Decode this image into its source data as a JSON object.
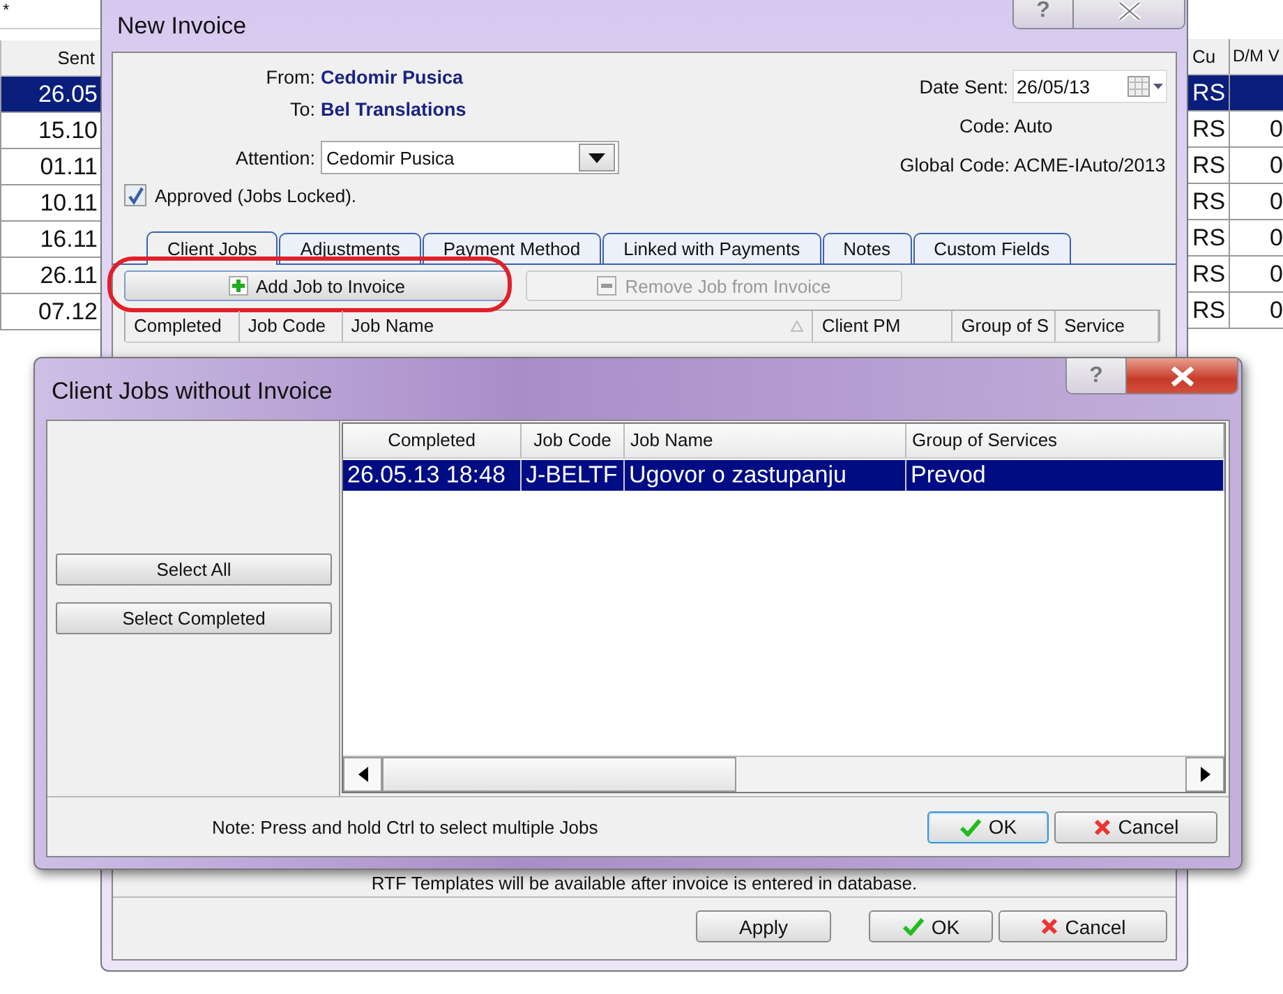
{
  "background": {
    "filter_text": "*",
    "columns": {
      "sent": "Sent",
      "cu": "Cu",
      "dm_v": "D/M V"
    },
    "rows": [
      {
        "sent": "26.05",
        "cu": "RS",
        "selected": true
      },
      {
        "sent": "15.10",
        "cu": "RS",
        "dm_v": "0",
        "selected": false
      },
      {
        "sent": "01.11",
        "cu": "RS",
        "dm_v": "0",
        "selected": false
      },
      {
        "sent": "10.11",
        "cu": "RS",
        "dm_v": "0",
        "selected": false
      },
      {
        "sent": "16.11",
        "cu": "RS",
        "dm_v": "0",
        "selected": false
      },
      {
        "sent": "26.11",
        "cu": "RS",
        "dm_v": "0",
        "selected": false
      },
      {
        "sent": "07.12",
        "cu": "RS",
        "dm_v": "0",
        "selected": false
      }
    ]
  },
  "invoice_window": {
    "title": "New Invoice",
    "help": "?",
    "from_label": "From:",
    "from": "Cedomir Pusica",
    "to_label": "To:",
    "to": "Bel Translations",
    "attention_label": "Attention:",
    "attention": "Cedomir Pusica",
    "approved": {
      "label": "Approved (Jobs Locked).",
      "checked": true
    },
    "date_sent_label": "Date Sent:",
    "date_sent": "26/05/13",
    "code_label": "Code:",
    "code": "Auto",
    "global_code_label": "Global Code:",
    "global_code": "ACME-IAuto/2013",
    "tabs": [
      {
        "label": "Client Jobs",
        "selected": true
      },
      {
        "label": "Adjustments",
        "selected": false
      },
      {
        "label": "Payment Method",
        "selected": false
      },
      {
        "label": "Linked with Payments",
        "selected": false
      },
      {
        "label": "Notes",
        "selected": false
      },
      {
        "label": "Custom Fields",
        "selected": false
      }
    ],
    "add_button": {
      "label": "Add Job to Invoice",
      "disabled": false,
      "circled": true
    },
    "remove_button": {
      "label": "Remove Job from Invoice",
      "disabled": true
    },
    "columns": [
      "Completed",
      "Job Code",
      "Job Name",
      "Client PM",
      "Group of S",
      "Service"
    ],
    "note": "RTF Templates will be available after invoice is entered in database.",
    "buttons": [
      {
        "kind": "plain",
        "label": "Apply"
      },
      {
        "kind": "ok",
        "label": "OK"
      },
      {
        "kind": "cancel",
        "label": "Cancel"
      }
    ]
  },
  "jobs_dialog": {
    "title": "Client Jobs without Invoice",
    "help": "?",
    "side_buttons": [
      "Select All",
      "Select Completed"
    ],
    "columns": [
      "Completed",
      "Job Code",
      "Job Name",
      "Group of Services"
    ],
    "rows": [
      {
        "cells": [
          "26.05.13 18:48",
          "J-BELTF",
          "Ugovor o zastupanju",
          "Prevod"
        ],
        "selected": true
      }
    ],
    "note": "Note: Press and hold Ctrl to select multiple Jobs",
    "buttons": [
      {
        "kind": "ok",
        "label": "OK"
      },
      {
        "kind": "cancel",
        "label": "Cancel"
      }
    ]
  }
}
